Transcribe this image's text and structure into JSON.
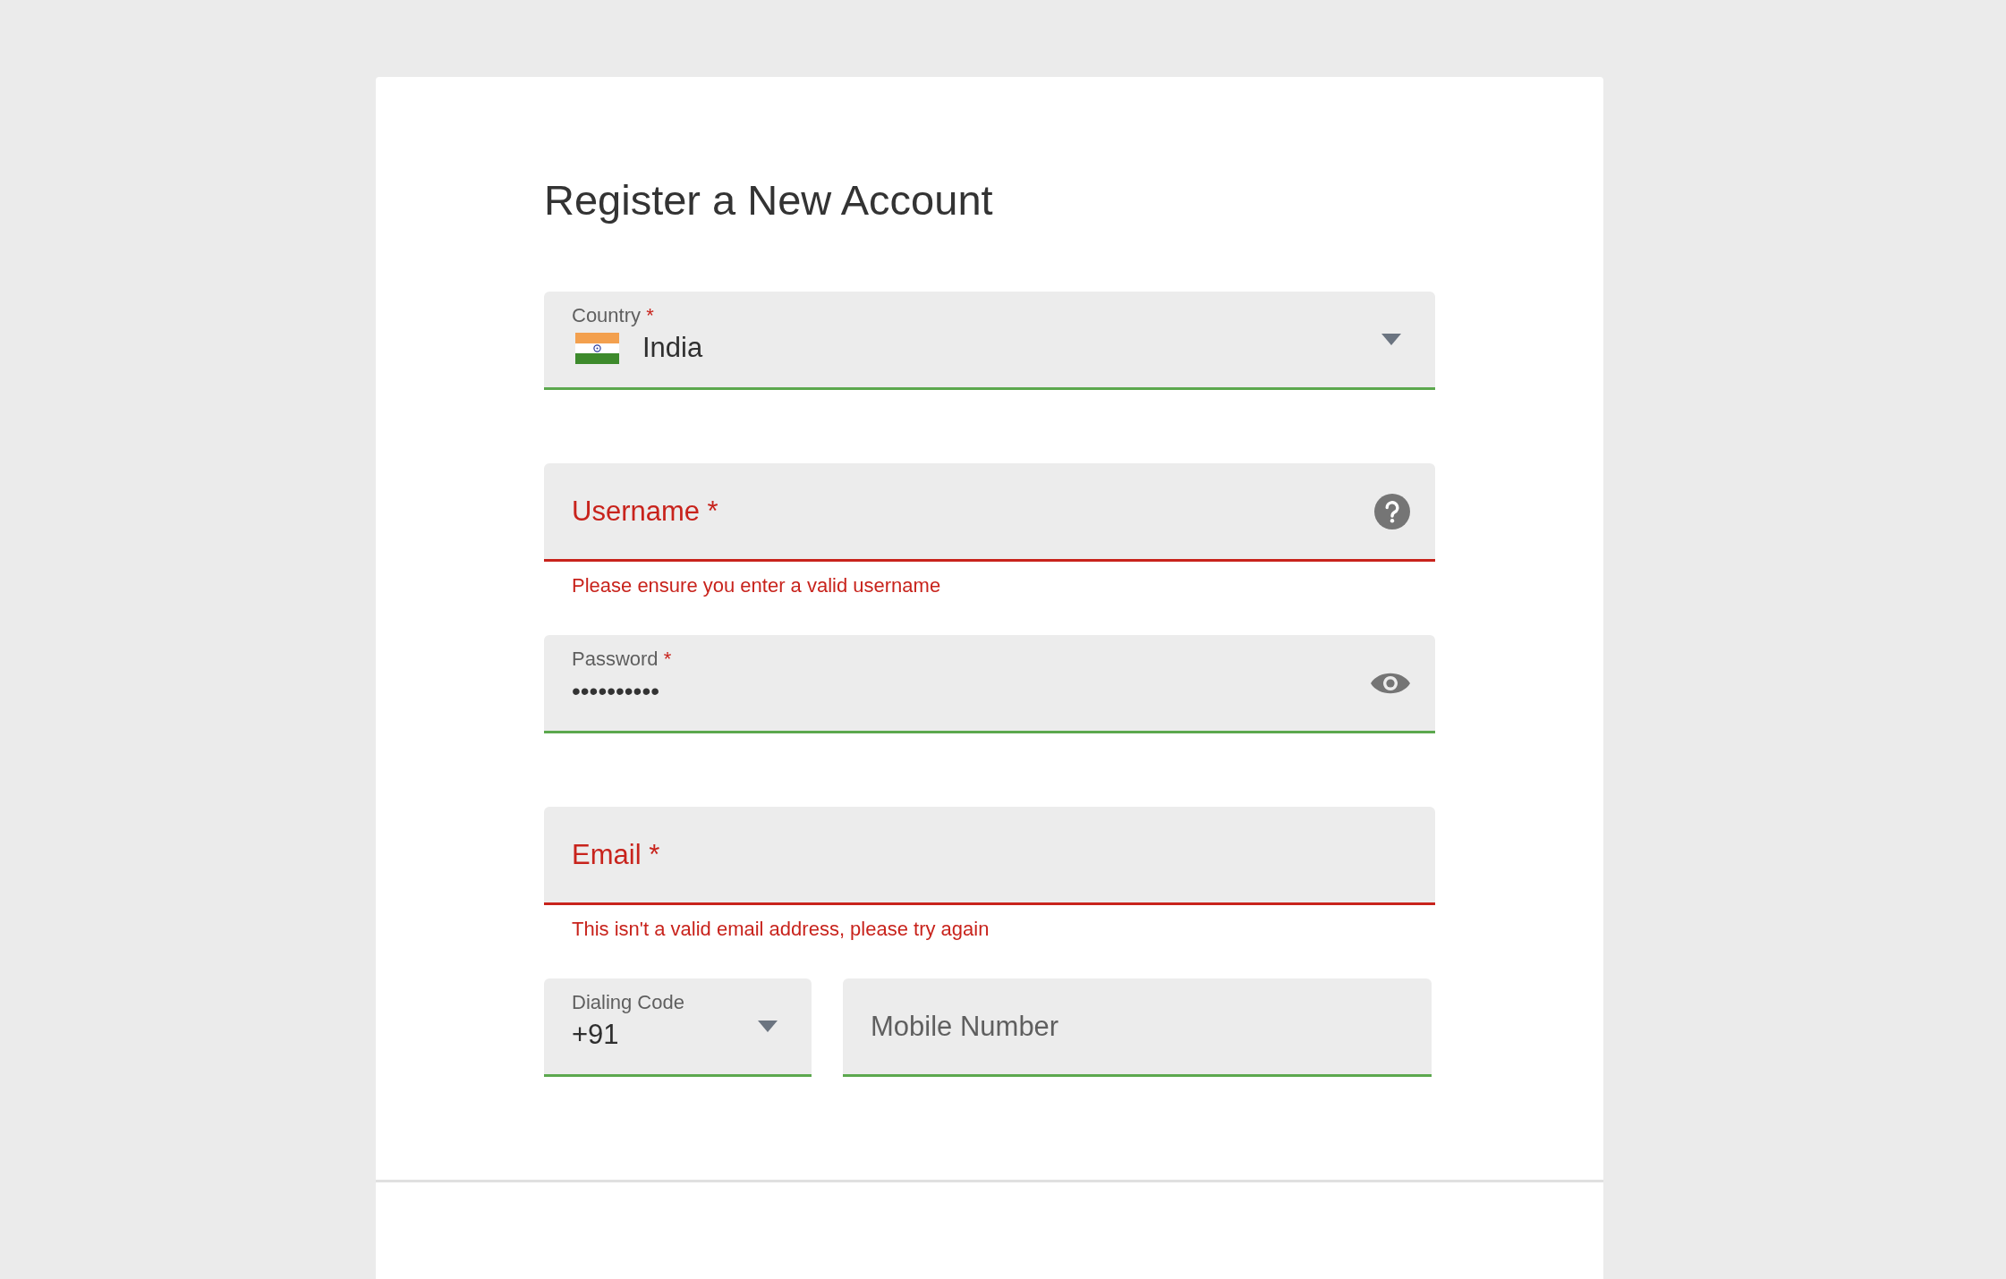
{
  "title": "Register a New Account",
  "fields": [
    {
      "kind": "country-select",
      "label": "Country",
      "required_mark": "*",
      "value": "India",
      "invalid": false
    },
    {
      "kind": "text",
      "label": "Username",
      "required_mark": "*",
      "invalid": true,
      "help": true,
      "error": "Please ensure you enter a valid username"
    },
    {
      "kind": "password",
      "label": "Password",
      "required_mark": "*",
      "value": "••••••••••",
      "invalid": false
    },
    {
      "kind": "text",
      "label": "Email",
      "required_mark": "*",
      "invalid": true,
      "error": "This isn't a valid email address, please try again"
    }
  ],
  "phone": [
    {
      "kind": "select",
      "label": "Dialing Code",
      "value": "+91",
      "invalid": false
    },
    {
      "kind": "text",
      "label": "Mobile Number",
      "invalid": false
    }
  ]
}
